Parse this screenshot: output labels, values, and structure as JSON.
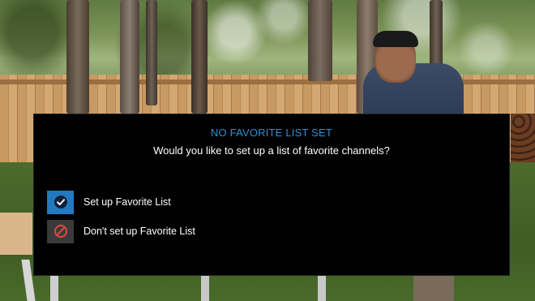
{
  "dialog": {
    "title": "NO FAVORITE LIST SET",
    "message": "Would you like to set up a list of favorite channels?",
    "options": [
      {
        "label": "Set up Favorite List",
        "icon": "checkmark-circle-icon",
        "selected": true,
        "color": "#2279c0"
      },
      {
        "label": "Don't set up Favorite List",
        "icon": "no-entry-icon",
        "selected": false,
        "color": "#e8453c"
      }
    ]
  },
  "colors": {
    "title_accent": "#2e8fd6",
    "dialog_background": "#000000"
  }
}
